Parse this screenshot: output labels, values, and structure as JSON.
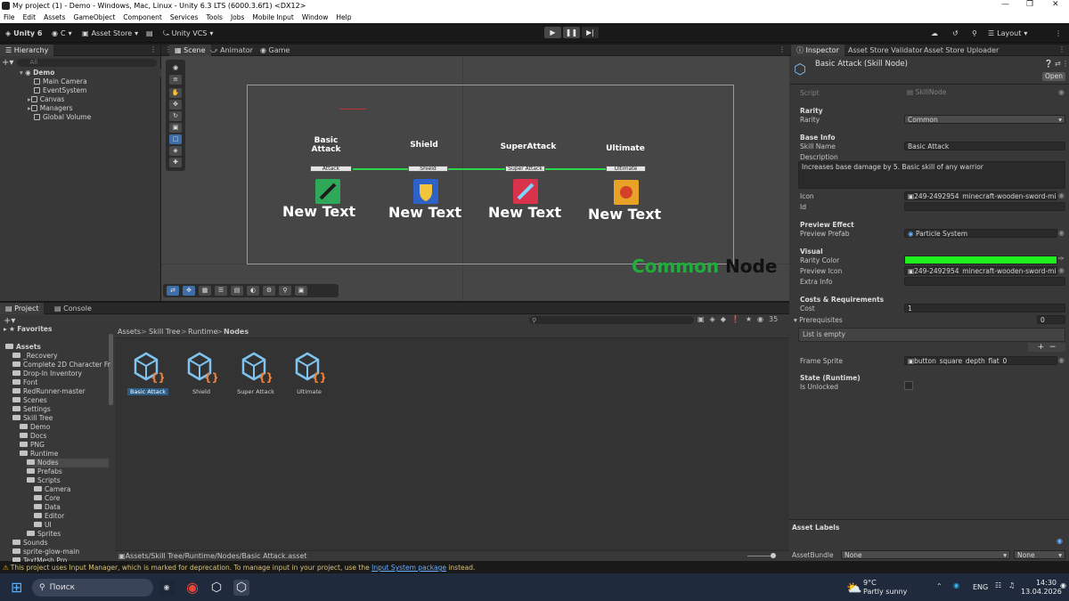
{
  "window": {
    "title": "My project (1) - Demo - Windows, Mac, Linux - Unity 6.3 LTS (6000.3.6f1) <DX12>"
  },
  "menu": [
    "File",
    "Edit",
    "Assets",
    "GameObject",
    "Component",
    "Services",
    "Tools",
    "Jobs",
    "Mobile Input",
    "Window",
    "Help"
  ],
  "toolbar": {
    "account": "Unity 6",
    "user": "C",
    "asset_store": "Asset Store",
    "vcs": "Unity VCS",
    "layout": "Layout"
  },
  "hierarchy": {
    "tab": "Hierarchy",
    "search_placeholder": "All",
    "items": [
      {
        "label": "Demo",
        "depth": 0,
        "scene": true
      },
      {
        "label": "Main Camera",
        "depth": 1
      },
      {
        "label": "EventSystem",
        "depth": 1
      },
      {
        "label": "Canvas",
        "depth": 1
      },
      {
        "label": "Managers",
        "depth": 1
      },
      {
        "label": "Global Volume",
        "depth": 1
      }
    ]
  },
  "scene": {
    "tabs": [
      "Scene",
      "Animator",
      "Game"
    ],
    "nodes": [
      {
        "title": "Basic\nAttack",
        "bar": "Attack",
        "text": "New Text",
        "color": "#2fa85a"
      },
      {
        "title": "Shield",
        "bar": "Shield",
        "text": "New Text",
        "color": "#2f62c8"
      },
      {
        "title": "SuperAttack",
        "bar": "Super Attack",
        "text": "New Text",
        "color": "#d8334a"
      },
      {
        "title": "Ultimate",
        "bar": "Ultimate",
        "text": "New Text",
        "color": "#e8a226"
      }
    ],
    "overlay_text_a": "Common",
    "overlay_text_b": "Node",
    "line_color": "#29d64a"
  },
  "inspector": {
    "tabs": [
      "Inspector",
      "Asset Store Validator",
      "Asset Store Uploader"
    ],
    "object_title": "Basic Attack (Skill Node)",
    "open_label": "Open",
    "script_label": "Script",
    "script_value": "SkillNode",
    "rarity_header": "Rarity",
    "rarity_label": "Rarity",
    "rarity_value": "Common",
    "baseinfo_header": "Base Info",
    "skillname_label": "Skill Name",
    "skillname_value": "Basic Attack",
    "description_label": "Description",
    "description_value": "Increases base damage by 5. Basic skill of any warrior",
    "icon_label": "Icon",
    "icon_value": "249-2492954_minecraft-wooden-sword-min",
    "id_label": "Id",
    "preview_header": "Preview Effect",
    "preview_prefab_label": "Preview Prefab",
    "preview_prefab_value": "Particle System",
    "visual_header": "Visual",
    "rarity_color_label": "Rarity Color",
    "rarity_color_value": "#1ef01e",
    "preview_icon_label": "Preview Icon",
    "preview_icon_value": "249-2492954_minecraft-wooden-sword-min",
    "extra_info_label": "Extra Info",
    "costs_header": "Costs & Requirements",
    "cost_label": "Cost",
    "cost_value": "1",
    "prereq_label": "Prerequisites",
    "prereq_count": "0",
    "list_empty": "List is empty",
    "frame_sprite_label": "Frame Sprite",
    "frame_sprite_value": "button_square_depth_flat_0",
    "state_header": "State (Runtime)",
    "is_unlocked_label": "Is Unlocked",
    "asset_labels": "Asset Labels",
    "assetbundle_label": "AssetBundle",
    "assetbundle_value": "None",
    "assetbundle_variant": "None"
  },
  "project": {
    "tabs": [
      "Project",
      "Console"
    ],
    "favorites": "Favorites",
    "tree": [
      {
        "label": "Assets",
        "depth": 0
      },
      {
        "label": "_Recovery",
        "depth": 1
      },
      {
        "label": "Complete 2D Character Fr",
        "depth": 1
      },
      {
        "label": "Drop-In Inventory",
        "depth": 1
      },
      {
        "label": "Font",
        "depth": 1
      },
      {
        "label": "RedRunner-master",
        "depth": 1
      },
      {
        "label": "Scenes",
        "depth": 1
      },
      {
        "label": "Settings",
        "depth": 1
      },
      {
        "label": "Skill Tree",
        "depth": 1
      },
      {
        "label": "Demo",
        "depth": 2
      },
      {
        "label": "Docs",
        "depth": 2
      },
      {
        "label": "PNG",
        "depth": 2
      },
      {
        "label": "Runtime",
        "depth": 2
      },
      {
        "label": "Nodes",
        "depth": 3,
        "selected": true
      },
      {
        "label": "Prefabs",
        "depth": 3
      },
      {
        "label": "Scripts",
        "depth": 3
      },
      {
        "label": "Camera",
        "depth": 4
      },
      {
        "label": "Core",
        "depth": 4
      },
      {
        "label": "Data",
        "depth": 4
      },
      {
        "label": "Editor",
        "depth": 4
      },
      {
        "label": "UI",
        "depth": 4
      },
      {
        "label": "Sprites",
        "depth": 3
      },
      {
        "label": "Sounds",
        "depth": 1
      },
      {
        "label": "sprite-glow-main",
        "depth": 1
      },
      {
        "label": "TextMesh Pro",
        "depth": 1
      }
    ],
    "breadcrumb": [
      "Assets",
      "Skill Tree",
      "Runtime",
      "Nodes"
    ],
    "assets": [
      "Basic Attack",
      "Shield",
      "Super Attack",
      "Ultimate"
    ],
    "hidden_count": "35",
    "path": "Assets/Skill Tree/Runtime/Nodes/Basic Attack.asset"
  },
  "status": {
    "message": "This project uses Input Manager, which is marked for deprecation. To manage input in your project, use the",
    "link": "Input System package",
    "suffix": "instead."
  },
  "taskbar": {
    "search": "Поиск",
    "temp": "9°C",
    "weather": "Partly sunny",
    "lang": "ENG",
    "time": "14:30",
    "date": "13.04.2026"
  }
}
